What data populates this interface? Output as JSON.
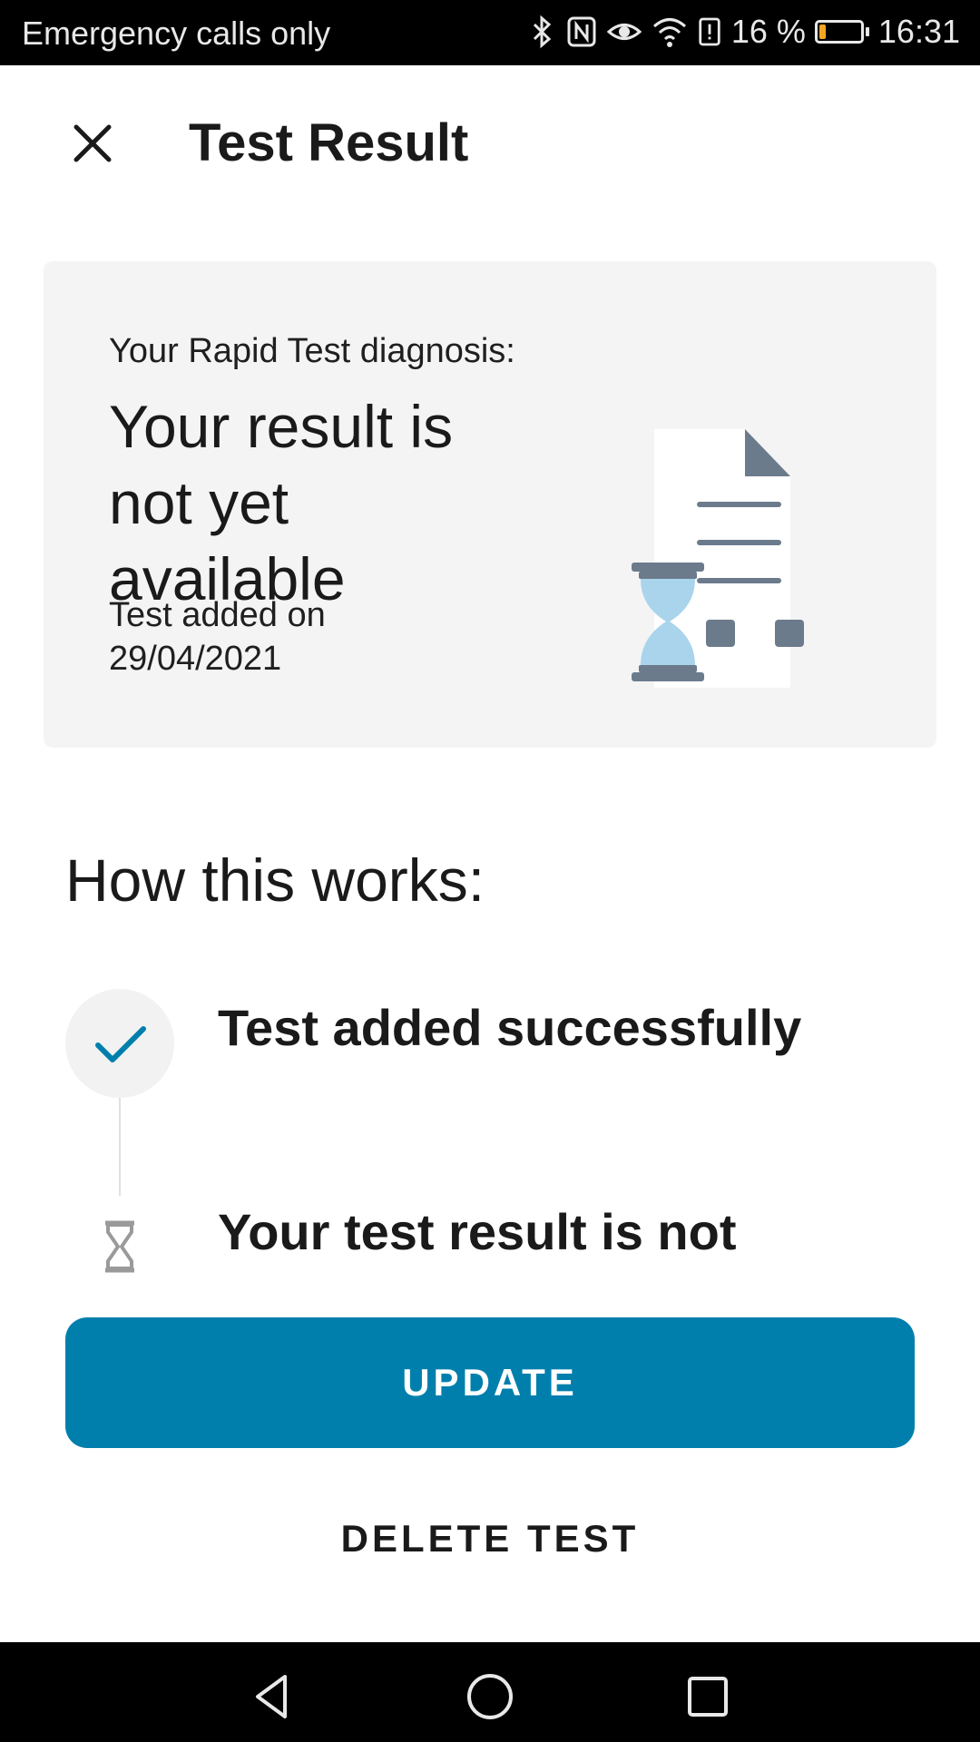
{
  "status_bar": {
    "carrier_text": "Emergency calls only",
    "battery_percent": "16 %",
    "battery_level": 0.16,
    "time": "16:31",
    "icons": [
      "bluetooth-icon",
      "nfc-icon",
      "eye-comfort-icon",
      "wifi-icon",
      "battery-alert-icon",
      "battery-icon"
    ]
  },
  "header": {
    "title": "Test Result",
    "close_icon": "close-icon"
  },
  "result_card": {
    "label": "Your Rapid Test diagnosis:",
    "status": "Your result is not yet available",
    "date_text": "Test added on 29/04/2021",
    "illustration": "document-hourglass-illustration"
  },
  "how_it_works": {
    "title": "How this works:",
    "steps": [
      {
        "label": "Test added successfully",
        "icon": "check-icon",
        "state": "done"
      },
      {
        "label": "Your test result is not",
        "icon": "hourglass-icon",
        "state": "pending"
      }
    ]
  },
  "actions": {
    "update_label": "UPDATE",
    "delete_label": "DELETE TEST"
  },
  "colors": {
    "primary": "#007fad",
    "card_bg": "#f4f4f4",
    "status_bar_bg": "#000000",
    "battery_warning": "#f5a623"
  },
  "nav_bar": {
    "buttons": [
      "back-icon",
      "home-icon",
      "recents-icon"
    ]
  }
}
